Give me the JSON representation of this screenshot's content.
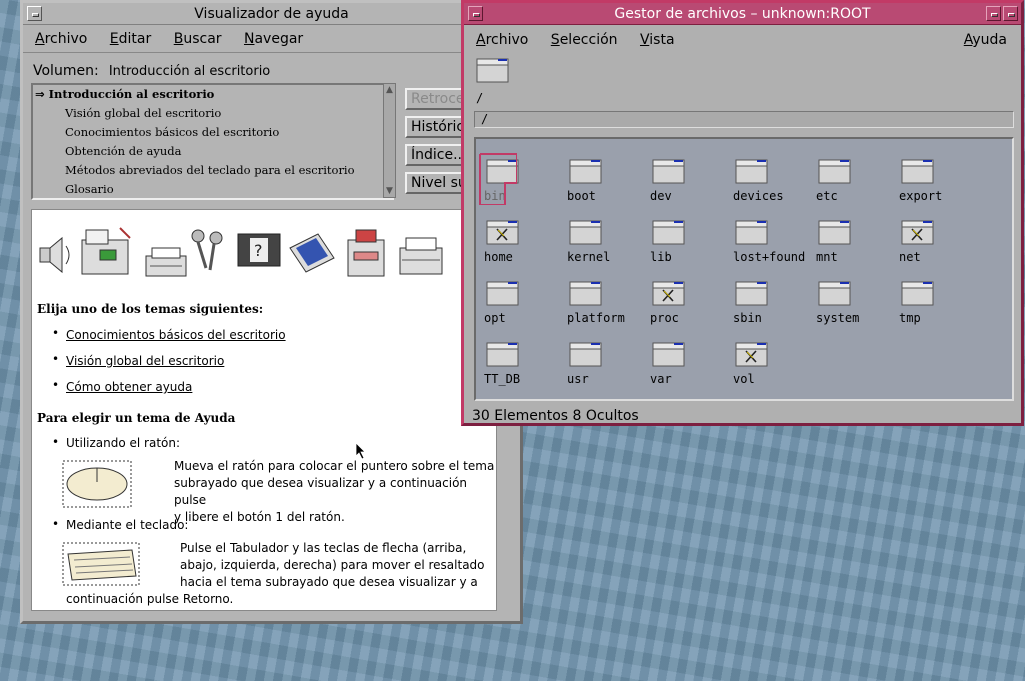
{
  "help_window": {
    "title": "Visualizador de ayuda",
    "menu": [
      "Archivo",
      "Editar",
      "Buscar",
      "Navegar"
    ],
    "volume_label": "Volumen:",
    "volume_value": "Introducción al escritorio",
    "toc": {
      "selected": "Introducción al escritorio",
      "items": [
        "Visión global del escritorio",
        "Conocimientos básicos del escritorio",
        "Obtención de ayuda",
        "Métodos abreviados del teclado para el escritorio",
        "Glosario"
      ]
    },
    "buttons": {
      "back": "Retroceder",
      "history": "Histórico...",
      "index": "Índice...",
      "top_level": "Nivel superior"
    },
    "content": {
      "choose_heading": "Elija uno de los temas siguientes:",
      "links": [
        "Conocimientos básicos del escritorio",
        "Visión global del escritorio",
        "Cómo obtener ayuda"
      ],
      "select_heading": "Para elegir un tema de Ayuda",
      "mouse_bullet": "Utilizando el ratón:",
      "mouse_text": [
        "Mueva el ratón para colocar el puntero sobre el tema",
        "subrayado que desea visualizar y a continuación pulse",
        "y libere el botón 1 del ratón."
      ],
      "keyboard_bullet": "Mediante el teclado:",
      "keyboard_text": [
        "Pulse el Tabulador y las teclas de flecha (arriba,",
        "abajo, izquierda, derecha) para mover el resaltado",
        "hacia el tema subrayado que desea visualizar y a",
        "continuación pulse Retorno."
      ]
    }
  },
  "file_manager": {
    "title": "Gestor de archivos – unknown:ROOT",
    "menu": [
      "Archivo",
      "Selección",
      "Vista"
    ],
    "help_menu": "Ayuda",
    "current_label": "/",
    "path": "/",
    "items": [
      {
        "name": "bin",
        "locked": false,
        "selected": true
      },
      {
        "name": "boot",
        "locked": false
      },
      {
        "name": "dev",
        "locked": false
      },
      {
        "name": "devices",
        "locked": false
      },
      {
        "name": "etc",
        "locked": false
      },
      {
        "name": "export",
        "locked": false
      },
      {
        "name": "home",
        "locked": true
      },
      {
        "name": "kernel",
        "locked": false
      },
      {
        "name": "lib",
        "locked": false
      },
      {
        "name": "lost+found",
        "locked": false
      },
      {
        "name": "mnt",
        "locked": false
      },
      {
        "name": "net",
        "locked": true
      },
      {
        "name": "opt",
        "locked": false
      },
      {
        "name": "platform",
        "locked": false
      },
      {
        "name": "proc",
        "locked": true
      },
      {
        "name": "sbin",
        "locked": false
      },
      {
        "name": "system",
        "locked": false
      },
      {
        "name": "tmp",
        "locked": false
      },
      {
        "name": "TT_DB",
        "locked": false
      },
      {
        "name": "usr",
        "locked": false
      },
      {
        "name": "var",
        "locked": false
      },
      {
        "name": "vol",
        "locked": true
      }
    ],
    "status": "30 Elementos 8 Ocultos"
  },
  "colors": {
    "desktop": "#6f93ad",
    "fm_title": "#b94a73",
    "selection": "#c23a66"
  }
}
